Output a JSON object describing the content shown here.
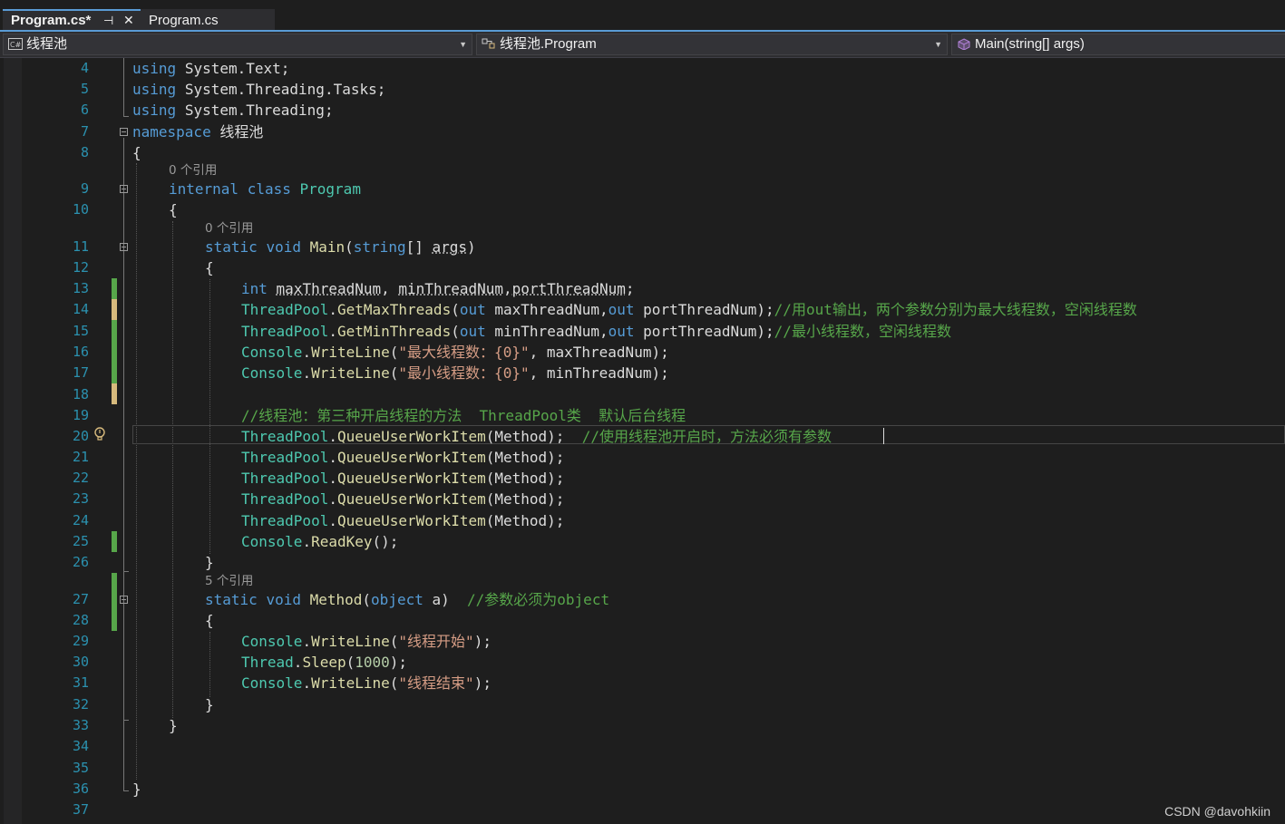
{
  "tabs": {
    "active_label": "Program.cs*",
    "inactive_label": "Program.cs",
    "pin_glyph": "⊣",
    "close_glyph": "✕"
  },
  "navbar": {
    "project": "线程池",
    "class": "线程池.Program",
    "member": "Main(string[] args)"
  },
  "colors": {
    "keyword": "#569cd6",
    "type": "#4ec9b0",
    "method": "#dcdcaa",
    "string": "#d69d85",
    "comment": "#57a64a",
    "line_number": "#2b91af"
  },
  "editor": {
    "line_numbers": [
      "4",
      "5",
      "6",
      "7",
      "8",
      "9",
      "10",
      "11",
      "12",
      "13",
      "14",
      "15",
      "16",
      "17",
      "18",
      "19",
      "20",
      "21",
      "22",
      "23",
      "24",
      "25",
      "26",
      "27",
      "28",
      "29",
      "30",
      "31",
      "32",
      "33",
      "34",
      "35",
      "36",
      "37"
    ],
    "lens_program": "0 个引用",
    "lens_main": "0 个引用",
    "lens_method": "5 个引用",
    "tokens": {
      "using": "using",
      "system_text": "System.Text;",
      "system_tasks": "System.Threading.Tasks;",
      "system_threading": "System.Threading;",
      "namespace": "namespace",
      "ns_name": "线程池",
      "open_brace": "{",
      "close_brace": "}",
      "internal": "internal",
      "class": "class",
      "program": "Program",
      "static": "static",
      "void": "void",
      "main": "Main",
      "lparen": "(",
      "rparen": ")",
      "string_kw": "string",
      "brackets_space": "[] ",
      "args": "args",
      "int": "int",
      "max_thread_num": "maxThreadNum",
      "min_thread_num": "minThreadNum",
      "port_thread_num": "portThreadNum",
      "comma_space": ", ",
      "comma": ",",
      "semicolon": ";",
      "thread_pool": "ThreadPool",
      "dot": ".",
      "get_max_threads": "GetMaxThreads",
      "get_min_threads": "GetMinThreads",
      "out": "out",
      "space": " ",
      "close_stmt": ");",
      "comment_l14": "//用out输出，两个参数分别为最大线程数，空闲线程数",
      "comment_l15": "//最小线程数，空闲线程数",
      "console": "Console",
      "write_line": "WriteLine",
      "str_max": "\"最大线程数：{0}\"",
      "str_min": "\"最小线程数：{0}\"",
      "comment_l19": "//线程池：第三种开启线程的方法  ThreadPool类  默认后台线程",
      "queue_user_work_item": "QueueUserWorkItem",
      "method_arg": "Method",
      "comment_l20": "//使用线程池开启时，方法必须有参数",
      "read_key": "ReadKey",
      "empty_call": "();",
      "method_name": "Method",
      "object_kw": "object",
      "param_a": " a",
      "comment_l27": "//参数必须为object",
      "str_start": "\"线程开始\"",
      "thread": "Thread",
      "sleep": "Sleep",
      "num_1000": "1000",
      "str_end": "\"线程结束\""
    }
  },
  "watermark": "CSDN @davohkiin"
}
